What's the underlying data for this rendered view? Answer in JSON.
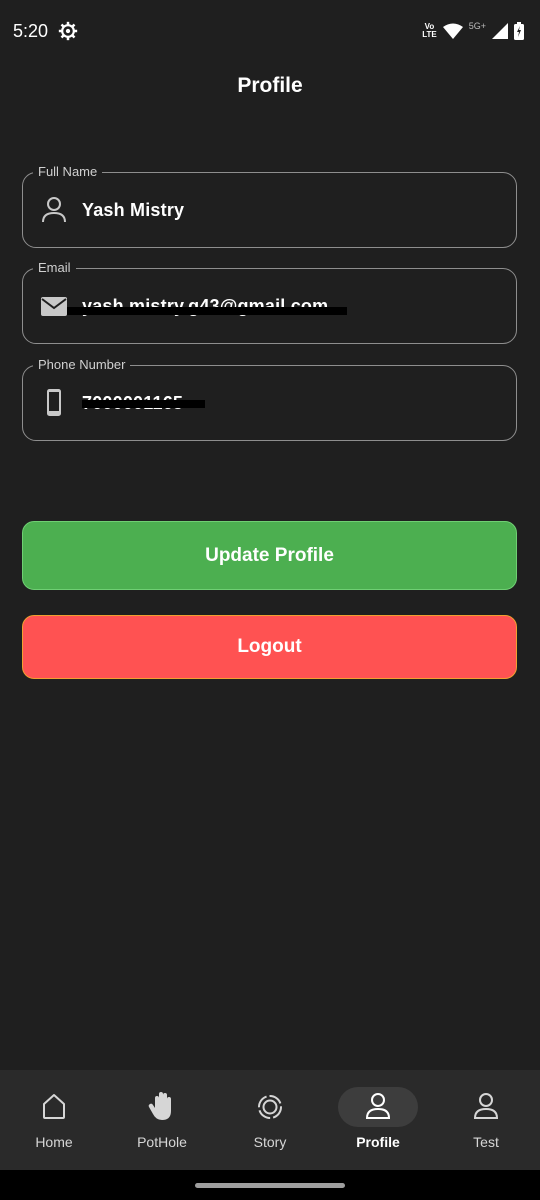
{
  "status_bar": {
    "time": "5:20",
    "volte_top": "Vo",
    "volte_bottom": "LTE",
    "network": "5G+"
  },
  "header": {
    "title": "Profile"
  },
  "form": {
    "full_name": {
      "label": "Full Name",
      "value": "Yash Mistry",
      "icon": "person-icon"
    },
    "email": {
      "label": "Email",
      "value": "yash.mistry.g43@gmail.com",
      "icon": "mail-icon"
    },
    "phone": {
      "label": "Phone Number",
      "value": "7000001165",
      "icon": "phone-icon"
    }
  },
  "actions": {
    "update_label": "Update Profile",
    "logout_label": "Logout",
    "update_color": "#4caf50",
    "logout_color": "#ff5252"
  },
  "bottom_nav": {
    "items": [
      {
        "label": "Home",
        "icon": "home-icon"
      },
      {
        "label": "PotHole",
        "icon": "hand-icon"
      },
      {
        "label": "Story",
        "icon": "story-icon"
      },
      {
        "label": "Profile",
        "icon": "person-icon",
        "active": true
      },
      {
        "label": "Test",
        "icon": "person-icon"
      }
    ]
  }
}
